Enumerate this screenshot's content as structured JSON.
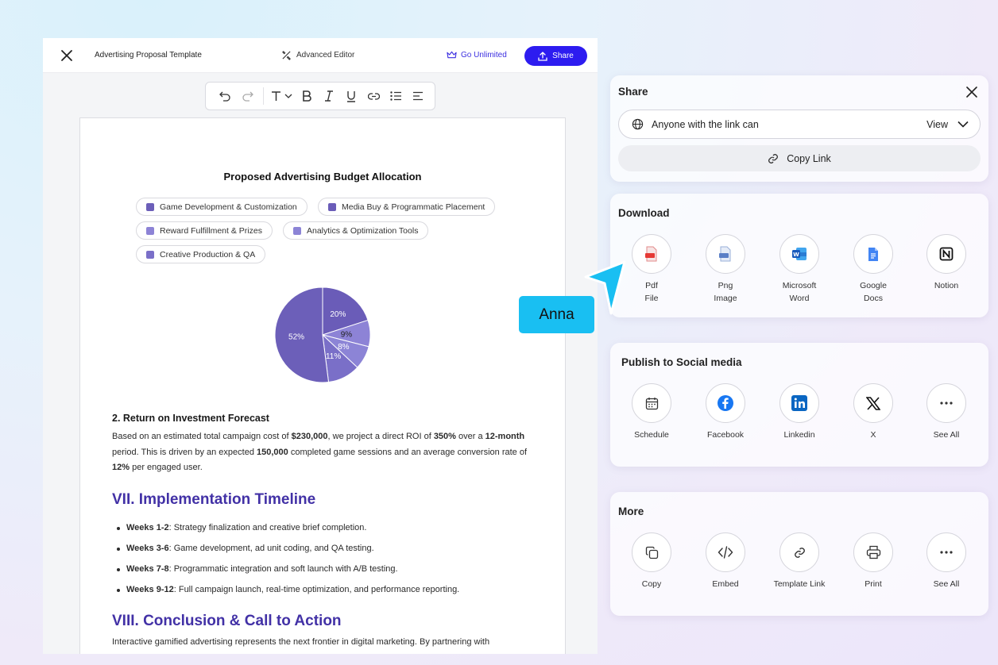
{
  "editor": {
    "title": "Advertising Proposal Template",
    "advanced_editor_label": "Advanced Editor",
    "go_unlimited_label": "Go Unlimited",
    "share_label": "Share"
  },
  "document": {
    "chart_data": {
      "type": "pie",
      "title": "Proposed Advertising Budget Allocation",
      "categories": [
        "Game Development & Customization",
        "Media Buy & Programmatic Placement",
        "Reward Fulfillment & Prizes",
        "Analytics & Optimization Tools",
        "Creative Production & QA"
      ],
      "values": [
        52,
        20,
        9,
        8,
        11
      ],
      "labels": [
        "52%",
        "20%",
        "9%",
        "8%",
        "11%"
      ],
      "colors": [
        "#6c5fb9",
        "#6a5cb8",
        "#8d83d6",
        "#8c84d6",
        "#7a6fc8"
      ],
      "legend_placement": "top"
    },
    "section2_heading": "2. Return on Investment Forecast",
    "section2_para": {
      "t1": "Based on an estimated total campaign cost of ",
      "b1": "$230,000",
      "t2": ", we project a direct ROI of ",
      "b2": "350%",
      "t3": " over a ",
      "b3": "12-month",
      "t4": " period. This is driven by an expected ",
      "b4": "150,000",
      "t5": " completed game sessions and an average conversion rate of ",
      "b5": "12%",
      "t6": " per engaged user."
    },
    "section7_heading": "VII. Implementation Timeline",
    "timeline": [
      {
        "bold": "Weeks 1-2",
        "text": ": Strategy finalization and creative brief completion."
      },
      {
        "bold": "Weeks 3-6",
        "text": ": Game development, ad unit coding, and QA testing."
      },
      {
        "bold": "Weeks 7-8",
        "text": ": Programmatic integration and soft launch with A/B testing."
      },
      {
        "bold": "Weeks 9-12",
        "text": ": Full campaign launch, real-time optimization, and performance reporting."
      }
    ],
    "section8_heading": "VIII. Conclusion & Call to Action",
    "section8_para": "Interactive gamified advertising represents the next frontier in digital marketing. By partnering with"
  },
  "share_panel": {
    "title": "Share",
    "access_text": "Anyone with the link can",
    "permission": "View",
    "copy_link_label": "Copy Link"
  },
  "download_panel": {
    "title": "Download",
    "options": [
      {
        "line1": "Pdf",
        "line2": "File",
        "icon": "pdf-file-icon"
      },
      {
        "line1": "Png",
        "line2": "Image",
        "icon": "png-image-icon"
      },
      {
        "line1": "Microsoft",
        "line2": "Word",
        "icon": "microsoft-word-icon"
      },
      {
        "line1": "Google",
        "line2": "Docs",
        "icon": "google-docs-icon"
      },
      {
        "line1": "Notion",
        "line2": "",
        "icon": "notion-icon"
      }
    ]
  },
  "social_panel": {
    "title": "Publish to Social media",
    "options": [
      {
        "label": "Schedule",
        "icon": "calendar-icon"
      },
      {
        "label": "Facebook",
        "icon": "facebook-icon"
      },
      {
        "label": "Linkedin",
        "icon": "linkedin-icon"
      },
      {
        "label": "X",
        "icon": "x-icon"
      },
      {
        "label": "See All",
        "icon": "more-icon"
      }
    ]
  },
  "more_panel": {
    "title": "More",
    "options": [
      {
        "label": "Copy",
        "icon": "copy-icon"
      },
      {
        "label": "Embed",
        "icon": "code-icon"
      },
      {
        "label": "Template Link",
        "icon": "link-icon"
      },
      {
        "label": "Print",
        "icon": "printer-icon"
      },
      {
        "label": "See All",
        "icon": "more-icon"
      }
    ]
  },
  "collaborator": {
    "name": "Anna",
    "color": "#19bff2"
  }
}
